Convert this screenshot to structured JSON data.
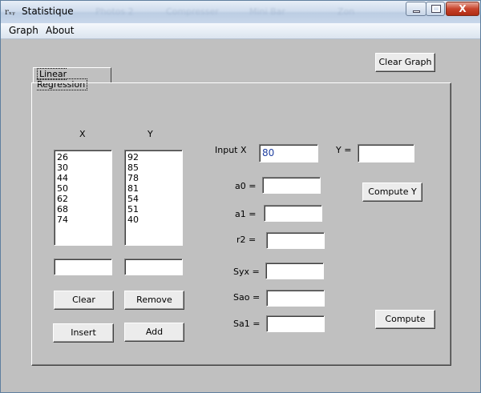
{
  "window": {
    "icon_text": "rₓᵧ",
    "title": "Statistique",
    "background_ghosts": [
      "Photos 2",
      "Compresser",
      "Mini Bar",
      "Zon"
    ],
    "close_glyph": "X"
  },
  "menu": [
    {
      "label": "Graph"
    },
    {
      "label": "About"
    }
  ],
  "toolbar": {
    "clear_graph_label": "Clear Graph"
  },
  "tab": {
    "label": "Linear Regression"
  },
  "columns": {
    "x_header": "X",
    "y_header": "Y"
  },
  "lists": {
    "x_values": [
      "26",
      "30",
      "44",
      "50",
      "62",
      "68",
      "74"
    ],
    "y_values": [
      "92",
      "85",
      "78",
      "81",
      "54",
      "51",
      "40"
    ]
  },
  "entry": {
    "x_value": "",
    "y_value": ""
  },
  "list_buttons": {
    "clear": "Clear",
    "remove": "Remove",
    "insert": "Insert",
    "add": "Add"
  },
  "predict": {
    "input_x_label": "Input X",
    "input_x_value": "80",
    "y_label": "Y =",
    "y_value": "",
    "compute_y_label": "Compute Y"
  },
  "results": [
    {
      "label": "a0 =",
      "value": ""
    },
    {
      "label": "a1 =",
      "value": ""
    },
    {
      "label": "r2 =",
      "value": ""
    },
    {
      "label": "Syx =",
      "value": ""
    },
    {
      "label": "Sao =",
      "value": ""
    },
    {
      "label": "Sa1 =",
      "value": ""
    }
  ],
  "compute_label": "Compute"
}
